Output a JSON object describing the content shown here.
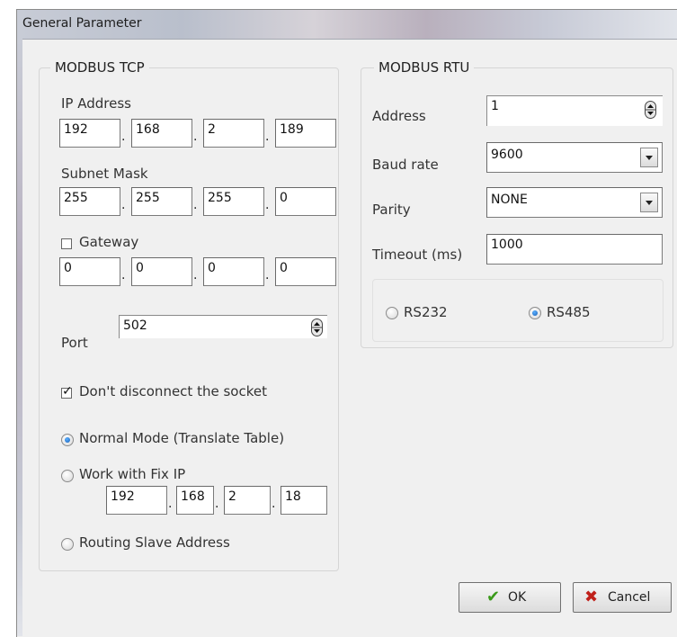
{
  "window": {
    "title": "General Parameter"
  },
  "tcp": {
    "legend": "MODBUS TCP",
    "ip_label": "IP Address",
    "ip": [
      "192",
      "168",
      "2",
      "189"
    ],
    "subnet_label": "Subnet Mask",
    "subnet": [
      "255",
      "255",
      "255",
      "0"
    ],
    "gateway_label": "Gateway",
    "gateway_checked": false,
    "gateway": [
      "0",
      "0",
      "0",
      "0"
    ],
    "port_label": "Port",
    "port": "502",
    "dont_disconnect_label": "Don't disconnect the socket",
    "dont_disconnect_checked": true,
    "mode_normal_label": "Normal Mode (Translate Table)",
    "mode_fixip_label": "Work with Fix IP",
    "fixip": [
      "192",
      "168",
      "2",
      "18"
    ],
    "mode_routing_label": "Routing Slave Address",
    "selected_mode": "normal"
  },
  "rtu": {
    "legend": "MODBUS RTU",
    "address_label": "Address",
    "address": "1",
    "baud_label": "Baud rate",
    "baud": "9600",
    "parity_label": "Parity",
    "parity": "NONE",
    "timeout_label": "Timeout (ms)",
    "timeout": "1000",
    "rs232_label": "RS232",
    "rs485_label": "RS485",
    "selected_interface": "RS485"
  },
  "buttons": {
    "ok": "OK",
    "cancel": "Cancel"
  },
  "colors": {
    "ok_check": "#3a9a1a",
    "cancel_x": "#c0201a",
    "radio_dot": "#1a5fb5"
  }
}
